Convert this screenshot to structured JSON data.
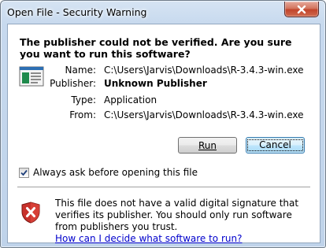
{
  "window": {
    "title": "Open File - Security Warning"
  },
  "heading": "The publisher could not be verified.  Are you sure you want to run this software?",
  "details": [
    {
      "label": "Name:",
      "value": "C:\\Users\\Jarvis\\Downloads\\R-3.4.3-win.exe",
      "bold": false
    },
    {
      "label": "Publisher:",
      "value": "Unknown Publisher",
      "bold": true
    },
    {
      "label": "Type:",
      "value": "Application",
      "bold": false
    },
    {
      "label": "From:",
      "value": "C:\\Users\\Jarvis\\Downloads\\R-3.4.3-win.exe",
      "bold": false
    }
  ],
  "buttons": {
    "run": "Run",
    "cancel": "Cancel"
  },
  "checkbox": {
    "label": "Always ask before opening this file",
    "checked": true
  },
  "warning": {
    "text": "This file does not have a valid digital signature that verifies its publisher.  You should only run software from publishers you trust.",
    "link": "How can I decide what software to run?"
  },
  "icons": {
    "close": "close-icon",
    "file": "application-icon",
    "shield": "security-shield-icon",
    "check": "checkmark-icon"
  },
  "colors": {
    "link": "#0000cc",
    "close_button": "#c2442b",
    "default_button_border": "#3c7fb1"
  }
}
